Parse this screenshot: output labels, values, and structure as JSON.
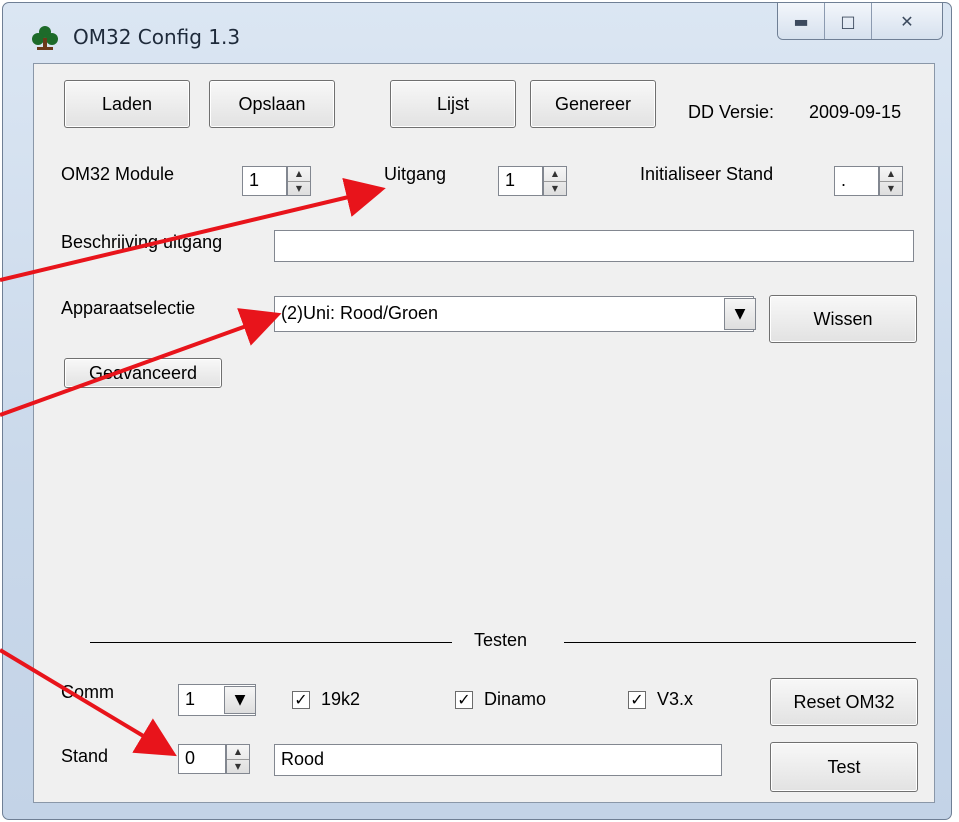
{
  "window": {
    "title": "OM32 Config 1.3",
    "minimize_icon": "minimize-icon",
    "maximize_icon": "maximize-icon",
    "close_icon": "close-icon"
  },
  "toolbar": {
    "laden": "Laden",
    "opslaan": "Opslaan",
    "lijst": "Lijst",
    "genereer": "Genereer",
    "version_label": "DD Versie:",
    "version_value": "2009-09-15"
  },
  "module": {
    "label": "OM32 Module",
    "value": "1"
  },
  "uitgang": {
    "label": "Uitgang",
    "value": "1"
  },
  "init_stand": {
    "label": "Initialiseer Stand",
    "value": "."
  },
  "beschrijving": {
    "label": "Beschrijving uitgang",
    "value": ""
  },
  "apparaat": {
    "label": "Apparaatselectie",
    "selected": "(2)Uni: Rood/Groen",
    "wissen": "Wissen"
  },
  "geavanceerd": "Geavanceerd",
  "testen": {
    "title": "Testen",
    "comm_label": "Comm",
    "comm_value": "1",
    "opt_19k2": "19k2",
    "opt_dinamo": "Dinamo",
    "opt_v3x": "V3.x",
    "checked": [
      true,
      true,
      true
    ],
    "reset": "Reset OM32",
    "stand_label": "Stand",
    "stand_value": "0",
    "stand_text": "Rood",
    "test": "Test"
  },
  "annotation_color": "#e8141b"
}
